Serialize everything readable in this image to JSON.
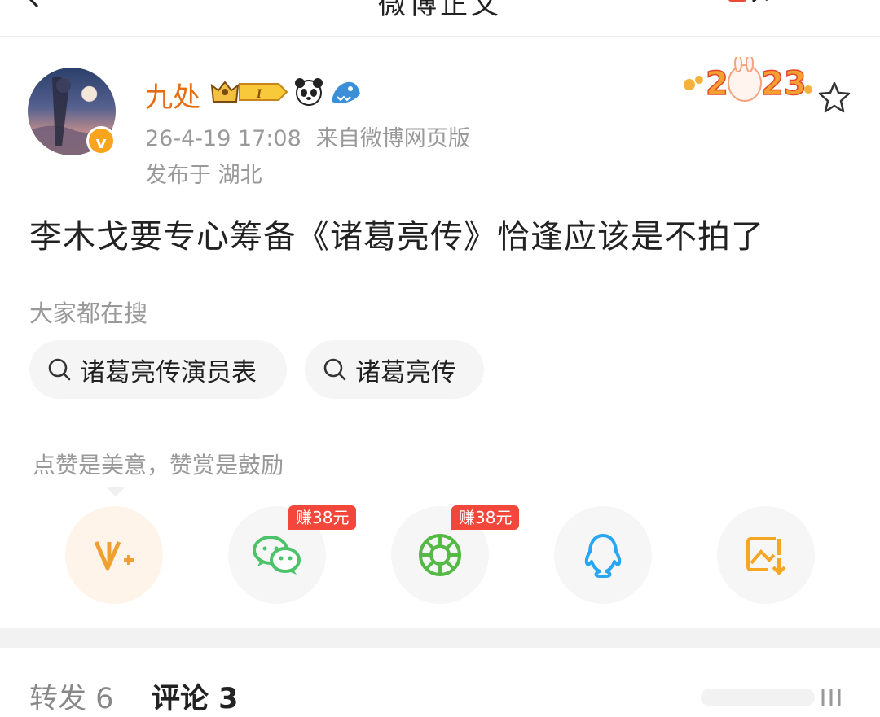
{
  "header": {
    "title": "微博正文"
  },
  "post": {
    "username": "九处",
    "time": "26-4-19 17:08",
    "source": "来自微博网页版",
    "location": "发布于 湖北",
    "text": "李木戈要专心筹备《诸葛亮传》恰逢应该是不拍了",
    "badge_level": "I",
    "verified_mark": "v"
  },
  "search": {
    "title": "大家都在搜",
    "chips": [
      "诸葛亮传演员表",
      "诸葛亮传"
    ]
  },
  "reward": {
    "hint": "点赞是美意，赞赏是鼓励"
  },
  "share": {
    "icons": [
      "v-plus-icon",
      "wechat-icon",
      "moments-icon",
      "qq-icon",
      "save-image-icon"
    ],
    "earn_label": "赚38元"
  },
  "tabs": {
    "repost": "转发 6",
    "comment": "评论 3"
  },
  "colors": {
    "username": "#e66d12",
    "earn_badge": "#f2473a",
    "wechat": "#4cc36a",
    "qq": "#2aa6f0",
    "save": "#f5a623",
    "v_plus": "#f0a030"
  }
}
